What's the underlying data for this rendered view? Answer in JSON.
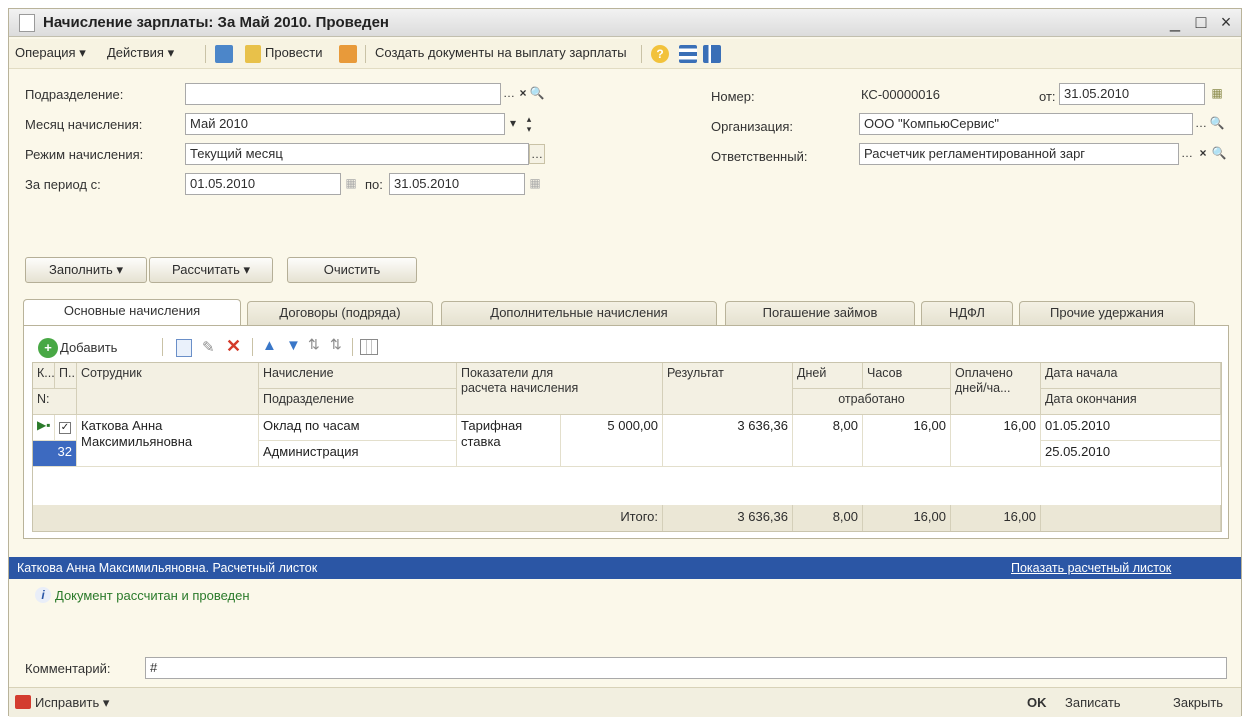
{
  "window": {
    "title": "Начисление зарплаты: За Май 2010. Проведен",
    "minimize": "_",
    "maximize": "□",
    "close": "×"
  },
  "toolbar": {
    "operation": "Операция ▾",
    "actions": "Действия ▾",
    "post": "Провести",
    "create_docs": "Создать документы на выплату зарплаты",
    "help": "?"
  },
  "form": {
    "division_label": "Подразделение:",
    "division_value": "",
    "month_label": "Месяц начисления:",
    "month_value": "Май 2010",
    "mode_label": "Режим начисления:",
    "mode_value": "Текущий месяц",
    "period_label": "За период с:",
    "period_from": "01.05.2010",
    "period_to_label": "по:",
    "period_to": "31.05.2010",
    "number_label": "Номер:",
    "number_value": "КС-00000016",
    "date_label": "от:",
    "date_value": "31.05.2010",
    "org_label": "Организация:",
    "org_value": "ООО \"КомпьюСервис\"",
    "resp_label": "Ответственный:",
    "resp_value": "Расчетчик регламентированной зарг"
  },
  "buttons": {
    "fill": "Заполнить ▾",
    "calculate": "Рассчитать ▾",
    "clear": "Очистить"
  },
  "tabs": [
    {
      "label": "Основные начисления"
    },
    {
      "label": "Договоры (подряда)"
    },
    {
      "label": "Дополнительные начисления"
    },
    {
      "label": "Погашение займов"
    },
    {
      "label": "НДФЛ"
    },
    {
      "label": "Прочие удержания"
    }
  ],
  "grid_toolbar": {
    "add": "Добавить"
  },
  "grid": {
    "headers": {
      "k": "К...",
      "p": "П...",
      "num": "N:",
      "employee": "Сотрудник",
      "accrual": "Начисление",
      "division": "Подразделение",
      "indicators": "Показатели для расчета начисления",
      "result": "Результат",
      "days": "Дней",
      "hours": "Часов",
      "worked": "отработано",
      "paid": "Оплачено дней/ча...",
      "date_start": "Дата начала",
      "date_end": "Дата окончания"
    },
    "row": {
      "num": "32",
      "employee": "Каткова Анна Максимильяновна",
      "accrual": "Оклад по часам",
      "division": "Администрация",
      "indicator": "Тарифная ставка",
      "indicator_value": "5 000,00",
      "result": "3 636,36",
      "days": "8,00",
      "hours": "16,00",
      "paid": "16,00",
      "date_start": "01.05.2010",
      "date_end": "25.05.2010"
    },
    "totals": {
      "label": "Итого:",
      "result": "3 636,36",
      "days": "8,00",
      "hours": "16,00",
      "paid": "16,00"
    }
  },
  "info": {
    "bar_text": "Каткова Анна Максимильяновна. Расчетный листок",
    "bar_link": "Показать расчетный листок",
    "status_msg": "Документ рассчитан и проведен"
  },
  "comment": {
    "label": "Комментарий:",
    "value": "#"
  },
  "status": {
    "fix": "Исправить ▾",
    "ok": "OK",
    "save": "Записать",
    "close": "Закрыть"
  },
  "colors": {
    "accent": "#2b56a5",
    "window_bg": "#fbf8ea",
    "ok_text": "#2a7a2a"
  }
}
